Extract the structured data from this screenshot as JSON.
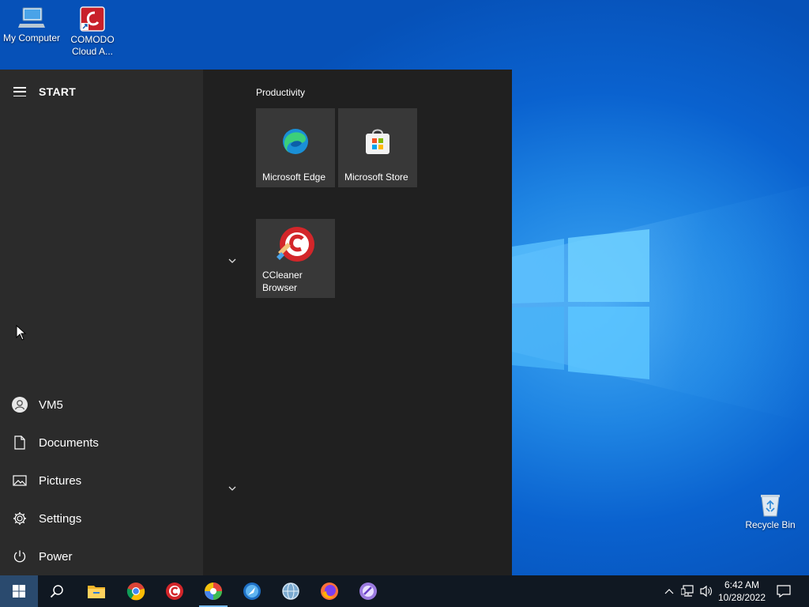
{
  "desktop": {
    "icons": [
      {
        "label": "My Computer",
        "icon": "computer-icon"
      },
      {
        "label": "COMODO Cloud A...",
        "icon": "comodo-cloud-antivirus-icon"
      },
      {
        "label": "Recycle Bin",
        "icon": "recycle-bin-icon"
      }
    ],
    "accent": "#0a62cf"
  },
  "start_menu": {
    "title": "START",
    "nav": [
      {
        "label": "VM5",
        "icon": "user-avatar-icon"
      },
      {
        "label": "Documents",
        "icon": "document-icon"
      },
      {
        "label": "Pictures",
        "icon": "pictures-icon"
      },
      {
        "label": "Settings",
        "icon": "gear-icon"
      },
      {
        "label": "Power",
        "icon": "power-icon"
      }
    ],
    "group": "Productivity",
    "tiles": [
      {
        "label": "Microsoft Edge",
        "icon": "edge-icon"
      },
      {
        "label": "Microsoft Store",
        "icon": "store-icon"
      },
      {
        "label": "CCleaner Browser",
        "icon": "ccleaner-browser-icon"
      }
    ]
  },
  "taskbar": {
    "apps": [
      "windows-start-icon",
      "search-icon",
      "file-explorer-icon",
      "chrome-icon",
      "ccleaner-icon",
      "color-browser-icon",
      "maxthon-icon",
      "network-globe-icon",
      "firefox-icon",
      "opera-like-icon"
    ],
    "clock": {
      "time": "6:42 AM",
      "date": "10/28/2022"
    }
  }
}
